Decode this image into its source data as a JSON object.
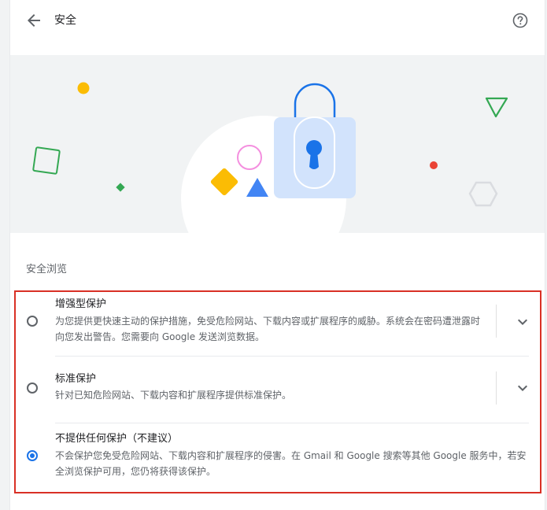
{
  "header": {
    "title": "安全",
    "back_icon": "arrow-back-icon",
    "help_icon": "help-circle-icon"
  },
  "colors": {
    "accent": "#1a73e8",
    "highlight_border": "#d93025",
    "banner_bg": "#f1f3f4"
  },
  "section": {
    "label": "安全浏览"
  },
  "options": [
    {
      "title": "增强型保护",
      "desc": "为您提供更快速主动的保护措施，免受危险网站、下载内容或扩展程序的威胁。系统会在密码遭泄露时向您发出警告。您需要向 Google 发送浏览数据。",
      "selected": false,
      "expandable": true
    },
    {
      "title": "标准保护",
      "desc": "针对已知危险网站、下载内容和扩展程序提供标准保护。",
      "selected": false,
      "expandable": true
    },
    {
      "title": "不提供任何保护（不建议）",
      "desc": "不会保护您免受危险网站、下载内容和扩展程序的侵害。在 Gmail 和 Google 搜索等其他 Google 服务中，若安全浏览保护可用，您仍将获得该保护。",
      "selected": true,
      "expandable": false
    }
  ]
}
